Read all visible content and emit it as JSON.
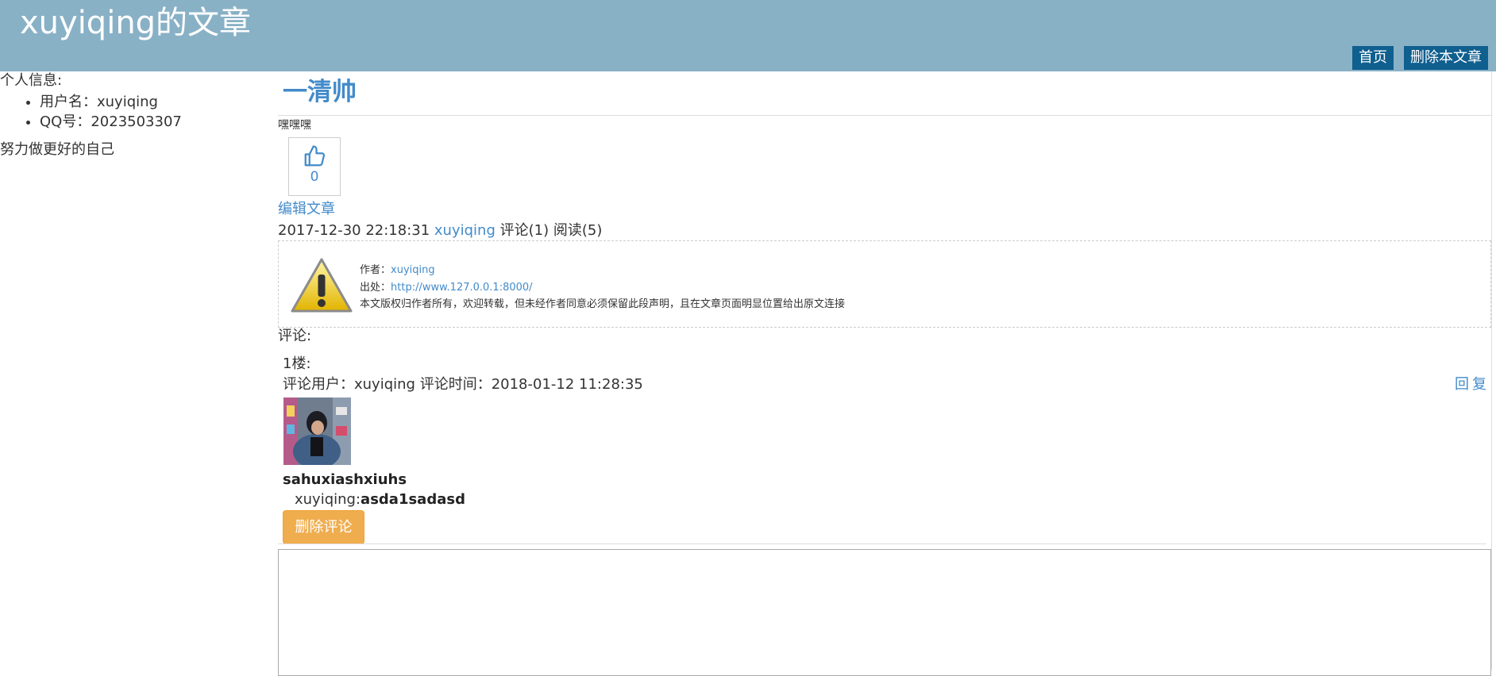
{
  "header": {
    "site_title": "xuyiqing的文章",
    "nav": {
      "home": "首页",
      "delete_article": "删除本文章"
    },
    "background": "#89b1c6",
    "button_color": "#0f5f8f"
  },
  "sidebar": {
    "heading": "个人信息:",
    "items": [
      {
        "label": "用户名：xuyiqing"
      },
      {
        "label": "QQ号：2023503307"
      }
    ],
    "motto": "努力做更好的自己"
  },
  "article": {
    "title": "一清帅",
    "excerpt": "嘿嘿嘿",
    "like_count": "0",
    "edit_label": "编辑文章",
    "meta": {
      "timestamp": "2017-12-30 22:18:31",
      "author": "xuyiqing",
      "comments": "评论(1)",
      "reads": "阅读(5)"
    },
    "accent": "#428bca"
  },
  "copyright": {
    "icon": "warning-icon",
    "author_label": "作者：",
    "author": "xuyiqing",
    "source_label": "出处：",
    "source": "http://www.127.0.0.1:8000/",
    "notice": "本文版权归作者所有，欢迎转载，但未经作者同意必须保留此段声明，且在文章页面明显位置给出原文连接"
  },
  "comments": {
    "label": "评论:",
    "items": [
      {
        "floor": "1楼:",
        "meta": "评论用户：xuyiqing 评论时间：2018-01-12 11:28:35",
        "reply": "回复",
        "commenter": "sahuxiashxiuhs",
        "reply_to": "xuyiqing:",
        "content": "asda1sadasd",
        "delete_label": "删除评论"
      }
    ],
    "delete_color": "#f0ad4e"
  }
}
